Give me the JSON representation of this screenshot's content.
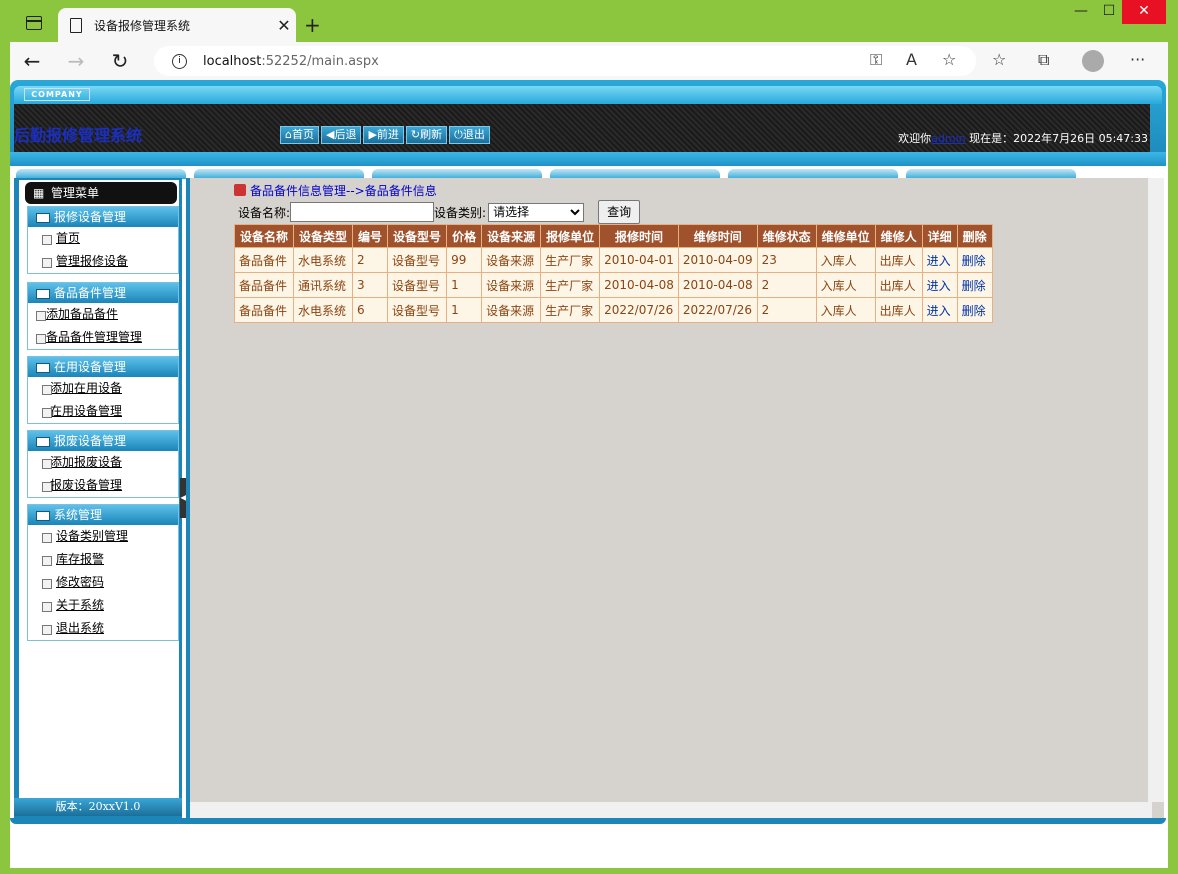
{
  "browser": {
    "tab_title": "设备报修管理系统",
    "url_host": "localhost",
    "url_rest": ":52252/main.aspx",
    "icons": [
      "tab-icon",
      "document-icon",
      "close-icon",
      "new-tab-icon",
      "back-icon",
      "forward-icon",
      "refresh-icon",
      "info-icon",
      "key-icon",
      "read-aloud-icon",
      "favorite-add-icon",
      "favorites-icon",
      "collections-icon",
      "profile-icon",
      "more-icon",
      "minimize-icon",
      "maximize-icon",
      "window-close-icon"
    ]
  },
  "header": {
    "company": "COMPANY",
    "title": "后勤报修管理系统",
    "nav": [
      "⌂首页",
      "◀后退",
      "▶前进",
      "↻刷新",
      "⏻退出"
    ],
    "welcome_prefix": "欢迎你",
    "user": "admin",
    "now_label": "现在是：",
    "datetime": "2022年7月26日 05:47:33"
  },
  "sidebar": {
    "head": "管理菜单",
    "groups": [
      {
        "title": "报修设备管理",
        "items": [
          "首页",
          "管理报修设备"
        ]
      },
      {
        "title": "备品备件管理",
        "items": [
          "添加备品备件",
          "备品备件管理管理"
        ]
      },
      {
        "title": "在用设备管理",
        "items": [
          "添加在用设备",
          "在用设备管理"
        ]
      },
      {
        "title": "报废设备管理",
        "items": [
          "添加报废设备",
          "报废设备管理"
        ]
      },
      {
        "title": "系统管理",
        "items": [
          "设备类别管理",
          "库存报警",
          "修改密码",
          "关于系统",
          "退出系统"
        ]
      }
    ],
    "version": "版本：20xxV1.0"
  },
  "main": {
    "breadcrumb": "备品备件信息管理-->备品备件信息",
    "form": {
      "name_label": "设备名称:",
      "name_value": "",
      "category_label": "设备类别:",
      "category_value": "请选择",
      "search_button": "查询"
    },
    "table": {
      "headers": [
        "设备名称",
        "设备类型",
        "编号",
        "设备型号",
        "价格",
        "设备来源",
        "报修单位",
        "报修时间",
        "维修时间",
        "维修状态",
        "维修单位",
        "维修人",
        "详细",
        "删除"
      ],
      "rows": [
        [
          "备品备件",
          "水电系统",
          "2",
          "设备型号",
          "99",
          "设备来源",
          "生产厂家",
          "2010-04-01",
          "2010-04-09",
          "23",
          "入库人",
          "出库人",
          "进入",
          "删除"
        ],
        [
          "备品备件",
          "通讯系统",
          "3",
          "设备型号",
          "1",
          "设备来源",
          "生产厂家",
          "2010-04-08",
          "2010-04-08",
          "2",
          "入库人",
          "出库人",
          "进入",
          "删除"
        ],
        [
          "备品备件",
          "水电系统",
          "6",
          "设备型号",
          "1",
          "设备来源",
          "生产厂家",
          "2022/07/26",
          "2022/07/26",
          "2",
          "入库人",
          "出库人",
          "进入",
          "删除"
        ]
      ]
    }
  }
}
